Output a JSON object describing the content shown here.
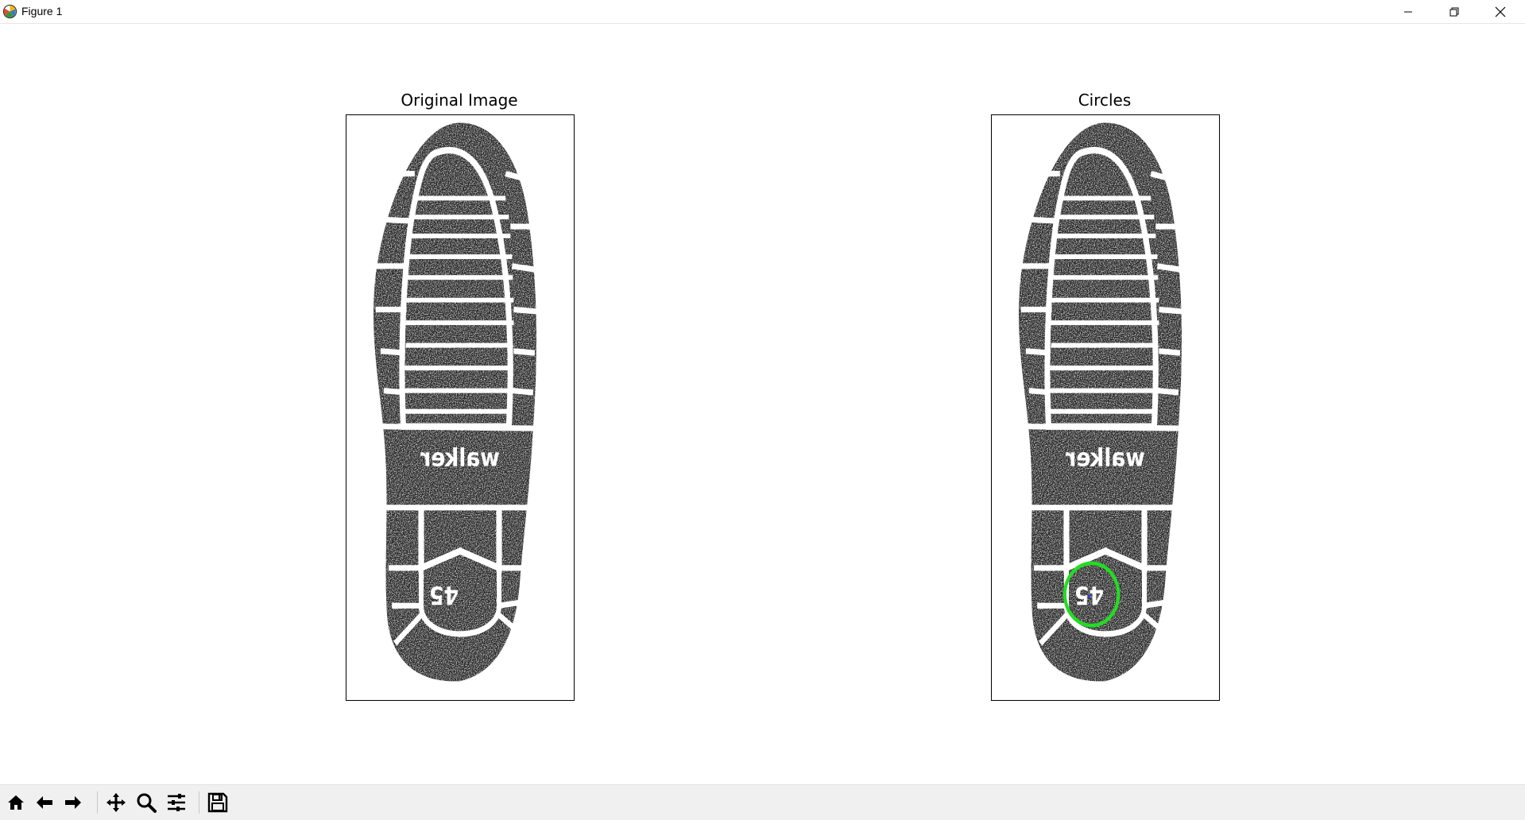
{
  "window": {
    "title": "Figure 1"
  },
  "axes": [
    {
      "title": "Original Image"
    },
    {
      "title": "Circles"
    }
  ],
  "detected_circle": {
    "color": "#22dd22"
  },
  "toolbar": {
    "buttons": [
      "home-icon",
      "back-icon",
      "forward-icon",
      "pan-icon",
      "zoom-icon",
      "configure-subplots-icon",
      "save-icon"
    ]
  }
}
